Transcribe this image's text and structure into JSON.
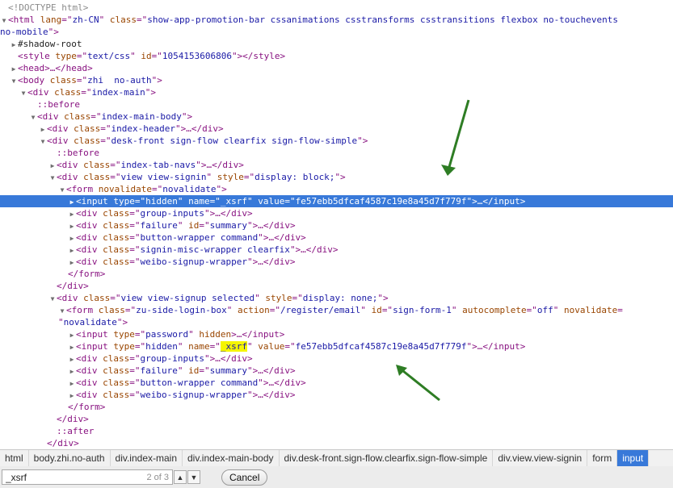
{
  "dom_tree": [
    {
      "id": "r0",
      "parts": [
        [
          "cm",
          "<!DOCTYPE html>"
        ]
      ]
    },
    {
      "id": "r1",
      "twisty": "open",
      "parts": [
        [
          "tg",
          "<html "
        ],
        [
          "an",
          "lang"
        ],
        [
          "tg",
          "=\""
        ],
        [
          "av",
          "zh-CN"
        ],
        [
          "tg",
          "\" "
        ],
        [
          "an",
          "class"
        ],
        [
          "tg",
          "=\""
        ],
        [
          "av",
          "show-app-promotion-bar cssanimations csstransforms csstransitions flexbox no-touchevents"
        ]
      ]
    },
    {
      "id": "r2",
      "parts": [
        [
          "av",
          "no-mobile"
        ],
        [
          "tg",
          "\">"
        ]
      ]
    },
    {
      "id": "r3",
      "twisty": "closed",
      "parts": [
        [
          "tx",
          "#shadow-root"
        ]
      ]
    },
    {
      "id": "r4",
      "parts": [
        [
          "tg",
          "<style "
        ],
        [
          "an",
          "type"
        ],
        [
          "tg",
          "=\""
        ],
        [
          "av",
          "text/css"
        ],
        [
          "tg",
          "\" "
        ],
        [
          "an",
          "id"
        ],
        [
          "tg",
          "=\""
        ],
        [
          "av",
          "1054153606806"
        ],
        [
          "tg",
          "\"></style>"
        ]
      ]
    },
    {
      "id": "r5",
      "twisty": "closed",
      "parts": [
        [
          "tg",
          "<head>…</head>"
        ]
      ]
    },
    {
      "id": "r6",
      "twisty": "open",
      "parts": [
        [
          "tg",
          "<body "
        ],
        [
          "an",
          "class"
        ],
        [
          "tg",
          "=\""
        ],
        [
          "av",
          "zhi  no-auth"
        ],
        [
          "tg",
          "\">"
        ]
      ]
    },
    {
      "id": "r7",
      "twisty": "open",
      "parts": [
        [
          "tg",
          "<div "
        ],
        [
          "an",
          "class"
        ],
        [
          "tg",
          "=\""
        ],
        [
          "av",
          "index-main"
        ],
        [
          "tg",
          "\">"
        ]
      ]
    },
    {
      "id": "r8",
      "parts": [
        [
          "pe",
          "::before"
        ]
      ]
    },
    {
      "id": "r9",
      "twisty": "open",
      "parts": [
        [
          "tg",
          "<div "
        ],
        [
          "an",
          "class"
        ],
        [
          "tg",
          "=\""
        ],
        [
          "av",
          "index-main-body"
        ],
        [
          "tg",
          "\">"
        ]
      ]
    },
    {
      "id": "r10",
      "twisty": "closed",
      "parts": [
        [
          "tg",
          "<div "
        ],
        [
          "an",
          "class"
        ],
        [
          "tg",
          "=\""
        ],
        [
          "av",
          "index-header"
        ],
        [
          "tg",
          "\">…</div>"
        ]
      ]
    },
    {
      "id": "r11",
      "twisty": "open",
      "parts": [
        [
          "tg",
          "<div "
        ],
        [
          "an",
          "class"
        ],
        [
          "tg",
          "=\""
        ],
        [
          "av",
          "desk-front sign-flow clearfix sign-flow-simple"
        ],
        [
          "tg",
          "\">"
        ]
      ]
    },
    {
      "id": "r12",
      "parts": [
        [
          "pe",
          "::before"
        ]
      ]
    },
    {
      "id": "r13",
      "twisty": "closed",
      "parts": [
        [
          "tg",
          "<div "
        ],
        [
          "an",
          "class"
        ],
        [
          "tg",
          "=\""
        ],
        [
          "av",
          "index-tab-navs"
        ],
        [
          "tg",
          "\">…</div>"
        ]
      ]
    },
    {
      "id": "r14",
      "twisty": "open",
      "parts": [
        [
          "tg",
          "<div "
        ],
        [
          "an",
          "class"
        ],
        [
          "tg",
          "=\""
        ],
        [
          "av",
          "view view-signin"
        ],
        [
          "tg",
          "\" "
        ],
        [
          "an",
          "style"
        ],
        [
          "tg",
          "=\""
        ],
        [
          "av",
          "display: block;"
        ],
        [
          "tg",
          "\">"
        ]
      ]
    },
    {
      "id": "r15",
      "twisty": "open",
      "parts": [
        [
          "tg",
          "<form "
        ],
        [
          "an",
          "novalidate"
        ],
        [
          "tg",
          "=\""
        ],
        [
          "av",
          "novalidate"
        ],
        [
          "tg",
          "\">"
        ]
      ]
    },
    {
      "id": "r16",
      "twisty": "closed",
      "parts": [
        [
          "tg",
          "<input "
        ],
        [
          "an",
          "type"
        ],
        [
          "tg",
          "=\""
        ],
        [
          "av",
          "hidden"
        ],
        [
          "tg",
          "\" "
        ],
        [
          "an",
          "name"
        ],
        [
          "tg",
          "=\""
        ],
        [
          "av",
          "_xsrf"
        ],
        [
          "tg",
          "\" "
        ],
        [
          "an",
          "value"
        ],
        [
          "tg",
          "=\""
        ],
        [
          "av",
          "fe57ebb5dfcaf4587c19e8a45d7f779f"
        ],
        [
          "tg",
          "\">…</input>"
        ]
      ]
    },
    {
      "id": "r17",
      "twisty": "closed",
      "parts": [
        [
          "tg",
          "<div "
        ],
        [
          "an",
          "class"
        ],
        [
          "tg",
          "=\""
        ],
        [
          "av",
          "group-inputs"
        ],
        [
          "tg",
          "\">…</div>"
        ]
      ]
    },
    {
      "id": "r18",
      "twisty": "closed",
      "parts": [
        [
          "tg",
          "<div "
        ],
        [
          "an",
          "class"
        ],
        [
          "tg",
          "=\""
        ],
        [
          "av",
          "failure"
        ],
        [
          "tg",
          "\" "
        ],
        [
          "an",
          "id"
        ],
        [
          "tg",
          "=\""
        ],
        [
          "av",
          "summary"
        ],
        [
          "tg",
          "\">…</div>"
        ]
      ]
    },
    {
      "id": "r19",
      "twisty": "closed",
      "parts": [
        [
          "tg",
          "<div "
        ],
        [
          "an",
          "class"
        ],
        [
          "tg",
          "=\""
        ],
        [
          "av",
          "button-wrapper command"
        ],
        [
          "tg",
          "\">…</div>"
        ]
      ]
    },
    {
      "id": "r20",
      "twisty": "closed",
      "parts": [
        [
          "tg",
          "<div "
        ],
        [
          "an",
          "class"
        ],
        [
          "tg",
          "=\""
        ],
        [
          "av",
          "signin-misc-wrapper clearfix"
        ],
        [
          "tg",
          "\">…</div>"
        ]
      ]
    },
    {
      "id": "r21",
      "twisty": "closed",
      "parts": [
        [
          "tg",
          "<div "
        ],
        [
          "an",
          "class"
        ],
        [
          "tg",
          "=\""
        ],
        [
          "av",
          "weibo-signup-wrapper"
        ],
        [
          "tg",
          "\">…</div>"
        ]
      ]
    },
    {
      "id": "r22",
      "parts": [
        [
          "tg",
          "</form>"
        ]
      ]
    },
    {
      "id": "r23",
      "parts": [
        [
          "tg",
          "</div>"
        ]
      ]
    },
    {
      "id": "r24",
      "twisty": "open",
      "parts": [
        [
          "tg",
          "<div "
        ],
        [
          "an",
          "class"
        ],
        [
          "tg",
          "=\""
        ],
        [
          "av",
          "view view-signup selected"
        ],
        [
          "tg",
          "\" "
        ],
        [
          "an",
          "style"
        ],
        [
          "tg",
          "=\""
        ],
        [
          "av",
          "display: none;"
        ],
        [
          "tg",
          "\">"
        ]
      ]
    },
    {
      "id": "r25",
      "twisty": "open",
      "parts": [
        [
          "tg",
          "<form "
        ],
        [
          "an",
          "class"
        ],
        [
          "tg",
          "=\""
        ],
        [
          "av",
          "zu-side-login-box"
        ],
        [
          "tg",
          "\" "
        ],
        [
          "an",
          "action"
        ],
        [
          "tg",
          "=\""
        ],
        [
          "av",
          "/register/email"
        ],
        [
          "tg",
          "\" "
        ],
        [
          "an",
          "id"
        ],
        [
          "tg",
          "=\""
        ],
        [
          "av",
          "sign-form-1"
        ],
        [
          "tg",
          "\" "
        ],
        [
          "an",
          "autocomplete"
        ],
        [
          "tg",
          "=\""
        ],
        [
          "av",
          "off"
        ],
        [
          "tg",
          "\" "
        ],
        [
          "an",
          "novalidate"
        ],
        [
          "tg",
          "="
        ]
      ]
    },
    {
      "id": "r26",
      "parts": [
        [
          "tg",
          "\""
        ],
        [
          "av",
          "novalidate"
        ],
        [
          "tg",
          "\">"
        ]
      ]
    },
    {
      "id": "r27",
      "twisty": "closed",
      "parts": [
        [
          "tg",
          "<input "
        ],
        [
          "an",
          "type"
        ],
        [
          "tg",
          "=\""
        ],
        [
          "av",
          "password"
        ],
        [
          "tg",
          "\" "
        ],
        [
          "an",
          "hidden"
        ],
        [
          "tg",
          ">…</input>"
        ]
      ]
    },
    {
      "id": "r28",
      "twisty": "closed",
      "parts": [
        [
          "tg",
          "<input "
        ],
        [
          "an",
          "type"
        ],
        [
          "tg",
          "=\""
        ],
        [
          "av",
          "hidden"
        ],
        [
          "tg",
          "\" "
        ],
        [
          "an",
          "name"
        ],
        [
          "tg",
          "=\""
        ],
        [
          "hl",
          "_xsrf"
        ],
        [
          "tg",
          "\" "
        ],
        [
          "an",
          "value"
        ],
        [
          "tg",
          "=\""
        ],
        [
          "av",
          "fe57ebb5dfcaf4587c19e8a45d7f779f"
        ],
        [
          "tg",
          "\">…</input>"
        ]
      ]
    },
    {
      "id": "r29",
      "twisty": "closed",
      "parts": [
        [
          "tg",
          "<div "
        ],
        [
          "an",
          "class"
        ],
        [
          "tg",
          "=\""
        ],
        [
          "av",
          "group-inputs"
        ],
        [
          "tg",
          "\">…</div>"
        ]
      ]
    },
    {
      "id": "r30",
      "twisty": "closed",
      "parts": [
        [
          "tg",
          "<div "
        ],
        [
          "an",
          "class"
        ],
        [
          "tg",
          "=\""
        ],
        [
          "av",
          "failure"
        ],
        [
          "tg",
          "\" "
        ],
        [
          "an",
          "id"
        ],
        [
          "tg",
          "=\""
        ],
        [
          "av",
          "summary"
        ],
        [
          "tg",
          "\">…</div>"
        ]
      ]
    },
    {
      "id": "r31",
      "twisty": "closed",
      "parts": [
        [
          "tg",
          "<div "
        ],
        [
          "an",
          "class"
        ],
        [
          "tg",
          "=\""
        ],
        [
          "av",
          "button-wrapper command"
        ],
        [
          "tg",
          "\">…</div>"
        ]
      ]
    },
    {
      "id": "r32",
      "twisty": "closed",
      "parts": [
        [
          "tg",
          "<div "
        ],
        [
          "an",
          "class"
        ],
        [
          "tg",
          "=\""
        ],
        [
          "av",
          "weibo-signup-wrapper"
        ],
        [
          "tg",
          "\">…</div>"
        ]
      ]
    },
    {
      "id": "r33",
      "parts": [
        [
          "tg",
          "</form>"
        ]
      ]
    },
    {
      "id": "r34",
      "parts": [
        [
          "tg",
          "</div>"
        ]
      ]
    },
    {
      "id": "r35",
      "parts": [
        [
          "pe",
          "::after"
        ]
      ]
    },
    {
      "id": "r36",
      "parts": [
        [
          "tg",
          "</div>"
        ]
      ]
    }
  ],
  "selected_row": "r16",
  "breadcrumbs": [
    "html",
    "body.zhi.no-auth",
    "div.index-main",
    "div.index-main-body",
    "div.desk-front.sign-flow.clearfix.sign-flow-simple",
    "div.view.view-signin",
    "form",
    "input"
  ],
  "active_breadcrumb": "input",
  "search": {
    "value": "_xsrf",
    "match_count": "2 of 3",
    "prev_icon": "up-arrow",
    "next_icon": "down-arrow",
    "cancel_label": "Cancel"
  },
  "colors": {
    "tag": "#881280",
    "attr_name": "#994500",
    "attr_value": "#1a1aa6",
    "selection": "#3879d9",
    "highlight": "#f5f500",
    "arrow": "#2e7d24"
  }
}
